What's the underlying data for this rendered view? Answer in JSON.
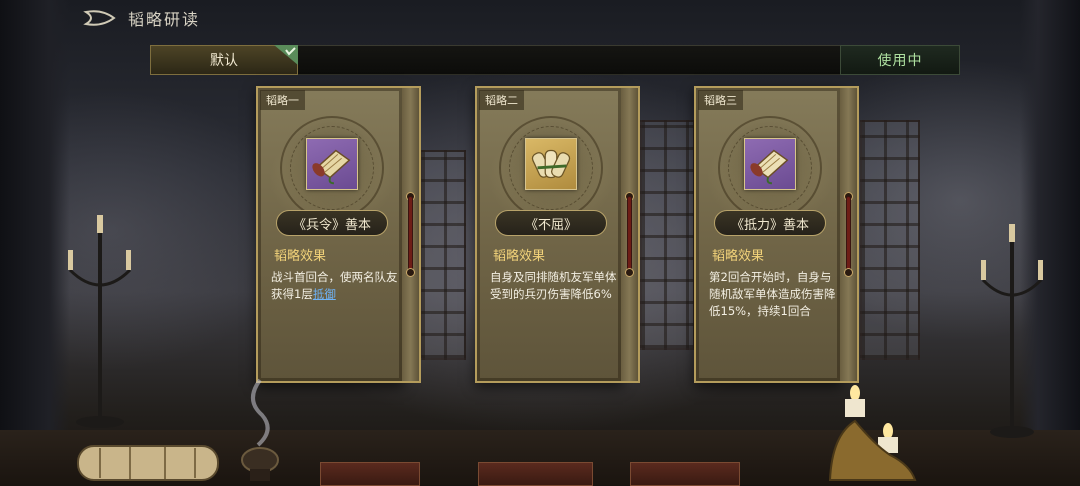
{
  "header": {
    "title": "韬略研读",
    "back_icon": "back-arrow-icon"
  },
  "tabs": {
    "default_label": "默认",
    "status_label": "使用中",
    "selected_check_icon": "checkmark-icon"
  },
  "cards": [
    {
      "slot_label": "韬略一",
      "item_name": "《兵令》善本",
      "item_icon": "scroll-book-icon",
      "frame_color": "#7d5aa2",
      "effect_heading": "韬略效果",
      "effect_text": "战斗首回合，使两名队友获得1层",
      "effect_link": "抵御"
    },
    {
      "slot_label": "韬略二",
      "item_name": "《不屈》",
      "item_icon": "scroll-bundle-icon",
      "frame_color": "#c8a552",
      "effect_heading": "韬略效果",
      "effect_text": "自身及同排随机友军单体受到的兵刃伤害降低6%"
    },
    {
      "slot_label": "韬略三",
      "item_name": "《抵力》善本",
      "item_icon": "scroll-book-icon",
      "frame_color": "#7d5aa2",
      "effect_heading": "韬略效果",
      "effect_text": "第2回合开始时，自身与随机敌军单体造成伤害降低15%，持续1回合"
    }
  ],
  "colors": {
    "effect_heading": "#f2d37a",
    "status_text": "#aee0a0",
    "link": "#6fb3f7"
  }
}
